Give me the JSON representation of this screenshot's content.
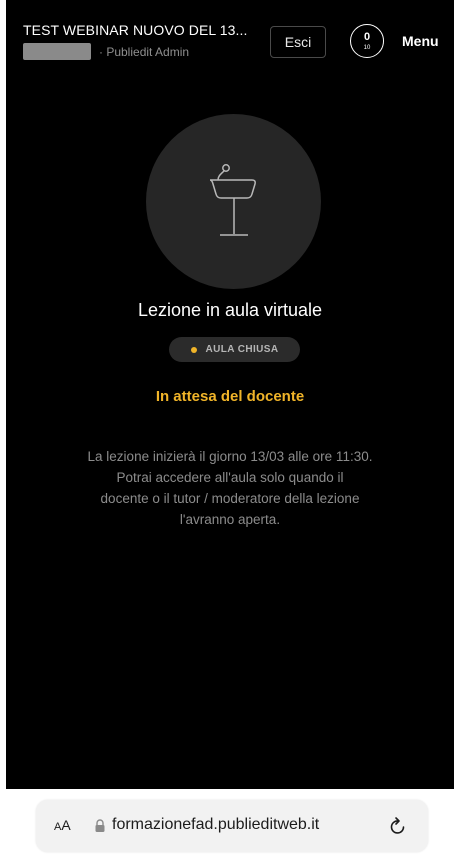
{
  "header": {
    "course_title": "TEST WEBINAR NUOVO DEL 13...",
    "author_role": "· Publiedit Admin",
    "exit_label": "Esci",
    "progress_current": "0",
    "progress_total": "10",
    "menu_label": "Menu"
  },
  "main": {
    "icon": "lectern-microphone-icon",
    "lesson_type": "Lezione in aula virtuale",
    "status_badge": "AULA CHIUSA",
    "status_color": "#f0b429",
    "waiting_title": "In attesa del docente",
    "info_line_1": "La lezione inizierà il giorno 13/03 alle ore 11:30.",
    "info_line_2": "Potrai accedere all'aula solo quando il",
    "info_line_3": "docente o il tutor / moderatore della lezione",
    "info_line_4": "l'avranno aperta."
  },
  "browser": {
    "text_size_small": "A",
    "text_size_large": "A",
    "url": "formazionefad.publieditweb.it",
    "lock_icon": "lock-icon",
    "reload_icon": "reload-icon"
  }
}
